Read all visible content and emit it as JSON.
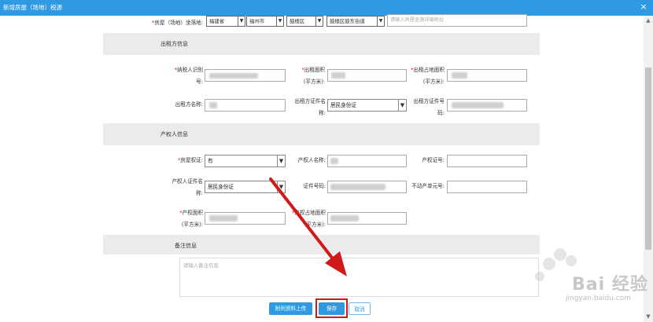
{
  "dialog": {
    "title": "新增房屋（场地）税源",
    "close_glyph": "×"
  },
  "address": {
    "label": "房屋（场地）坐落地:",
    "province": "福建省",
    "city": "福州市",
    "district": "鼓楼区",
    "street": "鼓楼区鼓东街道",
    "detail_placeholder": "请输入房屋坐落详细地址"
  },
  "lessor": {
    "section_title": "出租方信息",
    "taxpayer_id_label_1": "纳税人识别",
    "taxpayer_id_label_2": "号:",
    "rent_area_label_1": "出租面积",
    "rent_area_label_2": "(平方米):",
    "land_area_label_1": "出租占地面积",
    "land_area_label_2": "(平方米):",
    "name_label": "出租方名称:",
    "cert_type_label_1": "出租方证件名",
    "cert_type_label_2": "称:",
    "cert_type_value": "居民身份证",
    "cert_no_label_1": "出租方证件号",
    "cert_no_label_2": "码:"
  },
  "owner": {
    "section_title": "产权人信息",
    "has_cert_label": "房屋权证:",
    "has_cert_value": "有",
    "owner_name_label": "产权人名称:",
    "cert_no_label": "产权证号:",
    "owner_cert_type_label_1": "产权人证件名",
    "owner_cert_type_label_2": "称:",
    "owner_cert_type_value": "居民身份证",
    "id_no_label": "证件号码:",
    "unit_no_label": "不动产单元号:",
    "prop_area_label_1": "产权面积",
    "prop_area_label_2": "(平方米):",
    "prop_land_label_1": "产权占地面积",
    "prop_land_label_2": "(平方米):"
  },
  "remarks": {
    "section_title": "备注信息",
    "placeholder": "请输入备注信息"
  },
  "buttons": {
    "upload": "附列资料上传",
    "save": "保存",
    "cancel": "取消"
  },
  "watermark": {
    "brand": "Bai 经验",
    "url": "jingyan.baidu.com"
  },
  "colors": {
    "accent": "#2f9ae3",
    "highlight": "#d01a1a"
  }
}
